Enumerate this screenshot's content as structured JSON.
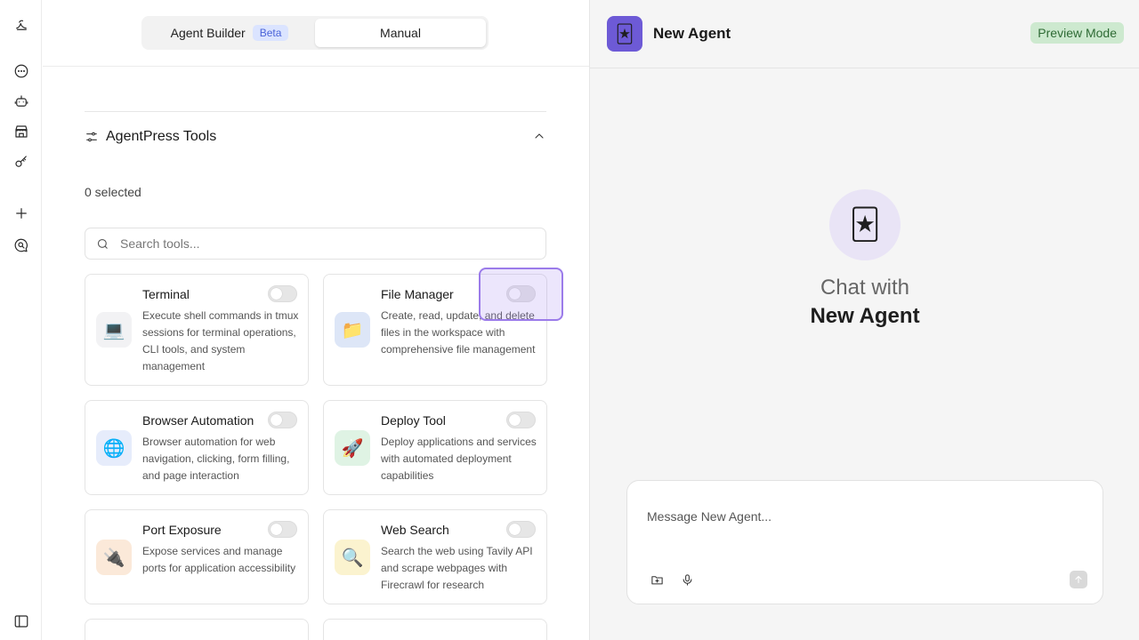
{
  "rail": {
    "icons": [
      "logo-icon",
      "chat-icon",
      "agent-icon",
      "marketplace-icon",
      "key-icon",
      "plus-icon",
      "search-chat-icon",
      "sidebar-toggle-icon"
    ]
  },
  "builder": {
    "tabs": [
      {
        "label": "Agent Builder",
        "badge": "Beta",
        "active": false
      },
      {
        "label": "Manual",
        "active": true
      }
    ]
  },
  "tools_section": {
    "title": "AgentPress Tools",
    "selected_text": "0 selected",
    "search_placeholder": "Search tools..."
  },
  "tools": [
    {
      "name": "Terminal",
      "emoji": "💻",
      "bg": "#f2f2f4",
      "desc": "Execute shell commands in tmux sessions for terminal operations, CLI tools, and system management",
      "enabled": false
    },
    {
      "name": "File Manager",
      "emoji": "📁",
      "bg": "#dde6f7",
      "desc": "Create, read, update, and delete files in the workspace with comprehensive file management",
      "enabled": false
    },
    {
      "name": "Browser Automation",
      "emoji": "🌐",
      "bg": "#e6ecfb",
      "desc": "Browser automation for web navigation, clicking, form filling, and page interaction",
      "enabled": false
    },
    {
      "name": "Deploy Tool",
      "emoji": "🚀",
      "bg": "#dff3e4",
      "desc": "Deploy applications and services with automated deployment capabilities",
      "enabled": false
    },
    {
      "name": "Port Exposure",
      "emoji": "🔌",
      "bg": "#fbe9d9",
      "desc": "Expose services and manage ports for application accessibility",
      "enabled": false
    },
    {
      "name": "Web Search",
      "emoji": "🔍",
      "bg": "#fbf3cf",
      "desc": "Search the web using Tavily API and scrape webpages with Firecrawl for research",
      "enabled": false
    }
  ],
  "preview": {
    "agent_name": "New Agent",
    "avatar_emoji": "🃏",
    "mode_badge": "Preview Mode",
    "chat_with": "Chat with",
    "chat_name": "New Agent",
    "message_placeholder": "Message New Agent..."
  },
  "colors": {
    "accent": "#6d5ad6",
    "beta_bg": "#dbe4ff",
    "preview_bg": "#cde9cf",
    "highlight": "#9b7bea"
  }
}
